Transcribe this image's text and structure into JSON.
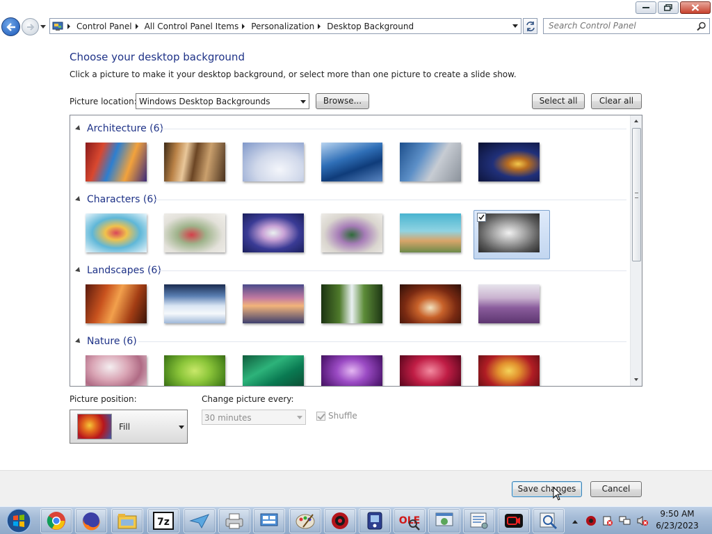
{
  "window": {
    "buttons": [
      "minimize",
      "restore",
      "close"
    ]
  },
  "navigation": {
    "breadcrumbs": [
      "Control Panel",
      "All Control Panel Items",
      "Personalization",
      "Desktop Background"
    ],
    "search_placeholder": "Search Control Panel"
  },
  "page": {
    "heading": "Choose your desktop background",
    "subtext": "Click a picture to make it your desktop background, or select more than one picture to create a slide show.",
    "location_label": "Picture location:",
    "location_value": "Windows Desktop Backgrounds",
    "browse_label": "Browse...",
    "select_all_label": "Select all",
    "clear_all_label": "Clear all"
  },
  "gallery": {
    "groups": [
      {
        "title": "Architecture (6)",
        "count": 6,
        "selected_index": null
      },
      {
        "title": "Characters (6)",
        "count": 6,
        "selected_index": 5
      },
      {
        "title": "Landscapes (6)",
        "count": 6,
        "selected_index": null
      },
      {
        "title": "Nature (6)",
        "count": 6,
        "selected_index": null
      }
    ]
  },
  "options": {
    "position_label": "Picture position:",
    "position_value": "Fill",
    "interval_label": "Change picture every:",
    "interval_value": "30 minutes",
    "shuffle_label": "Shuffle",
    "shuffle_checked": true
  },
  "footer": {
    "save_label": "Save changes",
    "cancel_label": "Cancel"
  },
  "taskbar": {
    "apps": [
      "chrome-icon",
      "firefox-icon",
      "explorer-icon",
      "7zip-icon",
      "mail-icon",
      "printer-icon",
      "network-icon",
      "paint-icon",
      "recovery-icon",
      "remote-icon",
      "ole-view-icon",
      "web-icon",
      "settings-icon",
      "recorder-icon",
      "search-tool-icon"
    ],
    "time": "9:50 AM",
    "date": "6/23/2023"
  }
}
